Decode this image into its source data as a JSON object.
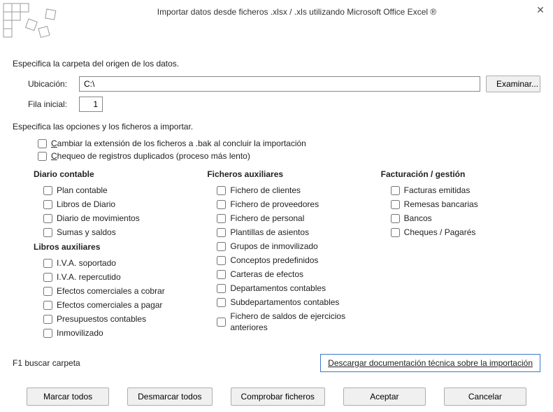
{
  "title": "Importar datos desde ficheros .xlsx / .xls utilizando Microsoft Office Excel ®",
  "section1": "Especifica la carpeta del origen de los datos.",
  "location_label": "Ubicación:",
  "location_value": "C:\\",
  "browse_label": "Examinar...",
  "startrow_label": "Fila inicial:",
  "startrow_value": "1",
  "section2": "Especifica las opciones y los ficheros a importar.",
  "opt_bak_pre": "C",
  "opt_bak_rest": "ambiar la extensión de los ficheros a .bak al concluir la importación",
  "opt_dup_pre": "C",
  "opt_dup_rest": "hequeo de registros duplicados (proceso más lento)",
  "col1_h1": "Diario contable",
  "col1_a": [
    "Plan contable",
    "Libros de Diario",
    "Diario de movimientos",
    "Sumas y saldos"
  ],
  "col1_h2": "Libros auxiliares",
  "col1_b": [
    "I.V.A. soportado",
    "I.V.A. repercutido",
    "Efectos comerciales a cobrar",
    "Efectos comerciales a pagar",
    "Presupuestos contables",
    "Inmovilizado"
  ],
  "col2_h": "Ficheros auxiliares",
  "col2": [
    "Fichero de clientes",
    "Fichero de proveedores",
    "Fichero de personal",
    "Plantillas de asientos",
    "Grupos de inmovilizado",
    "Conceptos predefinidos",
    "Carteras de efectos",
    "Departamentos contables",
    "Subdepartamentos contables",
    "Fichero de saldos de ejercicios anteriores"
  ],
  "col3_h": "Facturación / gestión",
  "col3": [
    "Facturas emitidas",
    "Remesas bancarias",
    "Bancos",
    "Cheques / Pagarés"
  ],
  "help_text": "F1 buscar carpeta",
  "doc_link": "Descargar documentación técnica sobre la importación",
  "btn_markall": "Marcar todos",
  "btn_unmarkall": "Desmarcar todos",
  "btn_check": "Comprobar ficheros",
  "btn_ok": "Aceptar",
  "btn_cancel": "Cancelar"
}
